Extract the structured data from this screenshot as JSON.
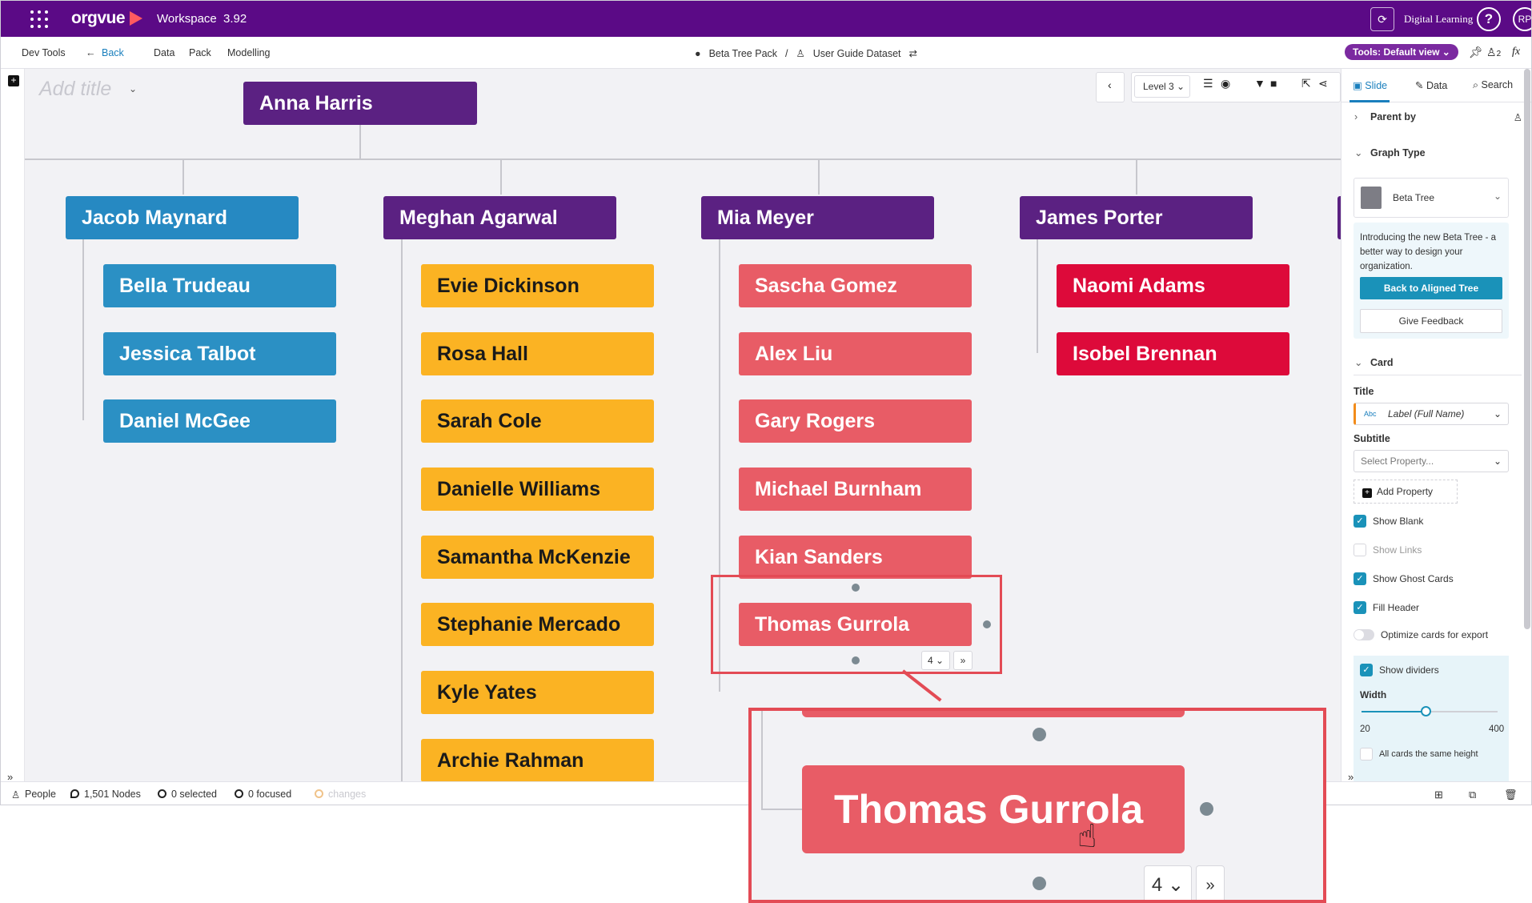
{
  "app": {
    "name": "orgvue",
    "workspace": "Workspace",
    "version": "3.92",
    "sync_icon": "sync-icon",
    "learning": "Digital Learning",
    "help": "?",
    "user_initials": "RP"
  },
  "menu": {
    "items": [
      "Dev Tools",
      "Back",
      "Data",
      "Pack",
      "Modelling"
    ],
    "pack": "Beta Tree Pack",
    "separator": "/",
    "dataset": "User Guide Dataset",
    "tools_view": "Tools: Default view",
    "badge_count": "2",
    "fx": "fx"
  },
  "canvas": {
    "add_title": "Add title",
    "level": "Level 3",
    "root": {
      "name": "Anna Harris",
      "color": "#5b2182"
    },
    "groups": [
      {
        "manager": "Jacob Maynard",
        "manager_color": "#2689c2",
        "color": "#2b90c4",
        "members": [
          "Bella Trudeau",
          "Jessica Talbot",
          "Daniel McGee"
        ]
      },
      {
        "manager": "Meghan Agarwal",
        "manager_color": "#5b2182",
        "color": "#fbb323",
        "members": [
          "Evie Dickinson",
          "Rosa Hall",
          "Sarah Cole",
          "Danielle Williams",
          "Samantha McKenzie",
          "Stephanie Mercado",
          "Kyle Yates",
          "Archie Rahman"
        ]
      },
      {
        "manager": "Mia Meyer",
        "manager_color": "#5b2182",
        "color": "#e85c66",
        "members": [
          "Sascha Gomez",
          "Alex Liu",
          "Gary Rogers",
          "Michael Burnham",
          "Kian Sanders",
          "Thomas Gurrola"
        ]
      },
      {
        "manager": "James Porter",
        "manager_color": "#5b2182",
        "color": "#dd0a3a",
        "members": [
          "Naomi Adams",
          "Isobel Brennan"
        ]
      }
    ],
    "selected_card": {
      "name": "Thomas Gurrola",
      "count": "4"
    }
  },
  "panel": {
    "tabs": [
      "Slide",
      "Data",
      "Search"
    ],
    "parent_by": "Parent by",
    "graph_type": "Graph Type",
    "graph_value": "Beta Tree",
    "intro": "Introducing the new Beta Tree - a better way to design your organization.",
    "back_btn": "Back to Aligned Tree",
    "feedback_btn": "Give Feedback",
    "card": "Card",
    "title_label": "Title",
    "title_value": "Label (Full Name)",
    "title_type": "Abc",
    "subtitle_label": "Subtitle",
    "subtitle_placeholder": "Select Property...",
    "add_property": "Add Property",
    "checks": [
      {
        "label": "Show Blank",
        "checked": true
      },
      {
        "label": "Show Links",
        "checked": false
      },
      {
        "label": "Show Ghost Cards",
        "checked": true
      },
      {
        "label": "Fill Header",
        "checked": true
      }
    ],
    "optimize": "Optimize cards for export",
    "show_dividers": "Show dividers",
    "width_label": "Width",
    "width_min": "20",
    "width_max": "400",
    "same_height": "All cards the same height"
  },
  "status": {
    "people": "People",
    "nodes": "1,501 Nodes",
    "selected": "0 selected",
    "focused": "0 focused",
    "changes": "changes"
  },
  "colors": {
    "brand": "#5b0a86",
    "accent": "#1a92b9",
    "highlight": "#e34b55"
  }
}
